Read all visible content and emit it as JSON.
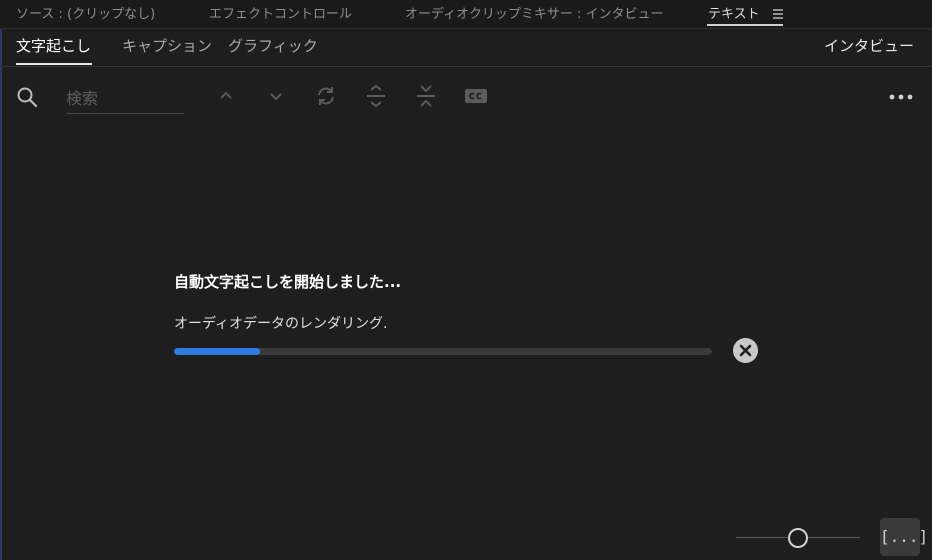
{
  "panel_tabs": [
    {
      "label": "ソース : (クリップなし)"
    },
    {
      "label": "エフェクトコントロール"
    },
    {
      "label": "オーディオクリップミキサー : インタビュー"
    },
    {
      "label": "テキスト"
    }
  ],
  "sub_tabs": [
    {
      "label": "文字起こし"
    },
    {
      "label": "キャプション"
    },
    {
      "label": "グラフィック"
    }
  ],
  "speaker_label": "インタビュー",
  "search": {
    "placeholder": "検索",
    "value": ""
  },
  "toolbar_icons": [
    "chevron-up-icon",
    "chevron-down-icon",
    "sync-icon",
    "merge-icon",
    "split-icon",
    "cc-icon",
    "more-icon"
  ],
  "status": {
    "title": "自動文字起こしを開始しました...",
    "subtitle": "オーディオデータのレンダリング.",
    "progress": 0.16
  },
  "bottom": {
    "zoom_value": 0.48,
    "expand_label": "[...]"
  },
  "colors": {
    "background": "#1e1e1e",
    "accent": "#2f7de1",
    "text": "#cfcfcf"
  }
}
